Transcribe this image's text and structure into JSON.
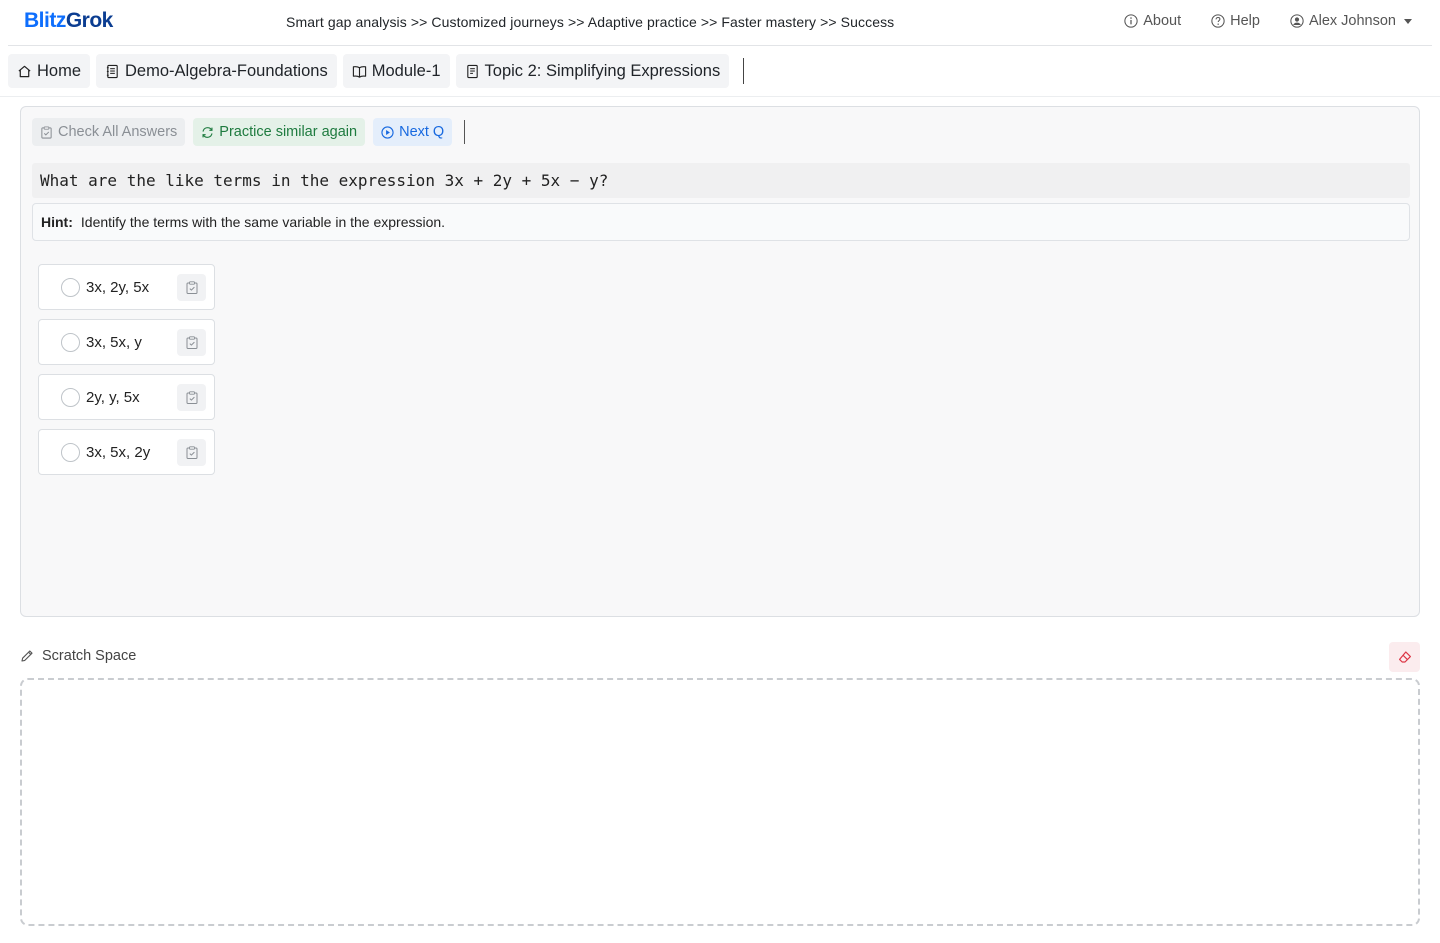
{
  "brand": {
    "part1": "Blitz",
    "part2": "Grok"
  },
  "tagline": "Smart gap analysis >> Customized journeys >> Adaptive practice >> Faster mastery >> Success",
  "nav": {
    "about": "About",
    "help": "Help",
    "user": "Alex Johnson"
  },
  "breadcrumbs": [
    {
      "label": "Home",
      "icon": "home-icon"
    },
    {
      "label": "Demo-Algebra-Foundations",
      "icon": "journal-icon"
    },
    {
      "label": "Module-1",
      "icon": "book-icon"
    },
    {
      "label": "Topic 2: Simplifying Expressions",
      "icon": "document-icon"
    }
  ],
  "toolbar": {
    "check_label": "Check All Answers",
    "practice_label": "Practice similar again",
    "next_label": "Next Q"
  },
  "question": {
    "text": "What are the like terms in the expression 3x + 2y + 5x − y?",
    "hint_label": "Hint:",
    "hint_text": "Identify the terms with the same variable in the expression.",
    "options": [
      {
        "label": "3x, 2y, 5x"
      },
      {
        "label": "3x, 5x, y"
      },
      {
        "label": "2y, y, 5x"
      },
      {
        "label": "3x, 5x, 2y"
      }
    ]
  },
  "scratch": {
    "title": "Scratch Space"
  },
  "colors": {
    "primary": "#0d6efd",
    "success": "#1e7b3f",
    "danger": "#dc3545"
  }
}
